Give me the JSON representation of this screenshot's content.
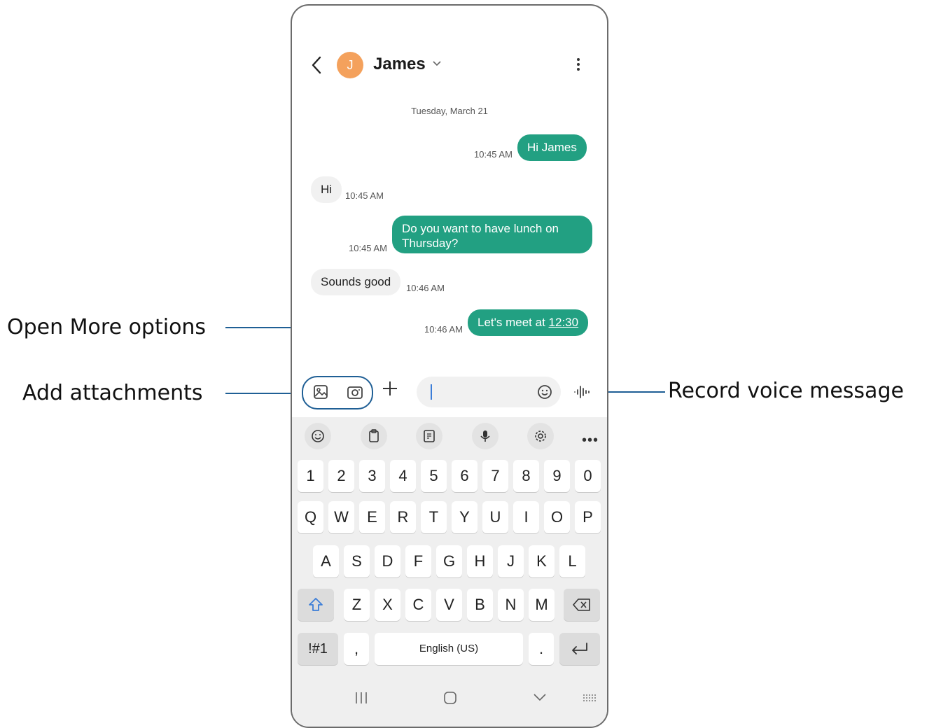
{
  "callouts": {
    "more_options": "Open More options",
    "attachments": "Add attachments",
    "voice": "Record voice message"
  },
  "header": {
    "avatar_initial": "J",
    "contact_name": "James"
  },
  "conversation": {
    "date": "Tuesday, March 21",
    "messages": [
      {
        "dir": "sent",
        "text": "Hi James",
        "time": "10:45 AM"
      },
      {
        "dir": "recv",
        "text": "Hi",
        "time": "10:45 AM"
      },
      {
        "dir": "sent",
        "text": "Do you want to have lunch on Thursday?",
        "time": "10:45 AM"
      },
      {
        "dir": "recv",
        "text": "Sounds good",
        "time": "10:46 AM"
      },
      {
        "dir": "sent",
        "text": "Let's meet at ",
        "link": "12:30",
        "time": "10:46 AM"
      }
    ]
  },
  "keyboard": {
    "row_numbers": [
      "1",
      "2",
      "3",
      "4",
      "5",
      "6",
      "7",
      "8",
      "9",
      "0"
    ],
    "row_top": [
      "Q",
      "W",
      "E",
      "R",
      "T",
      "Y",
      "U",
      "I",
      "O",
      "P"
    ],
    "row_middle": [
      "A",
      "S",
      "D",
      "F",
      "G",
      "H",
      "J",
      "K",
      "L"
    ],
    "row_bottom": [
      "Z",
      "X",
      "C",
      "V",
      "B",
      "N",
      "M"
    ],
    "symbols_key": "!#1",
    "comma_key": ",",
    "space_label": "English (US)",
    "period_key": "."
  },
  "colors": {
    "sent_bubble": "#22a082",
    "received_bubble": "#f1f1f1",
    "avatar": "#f4a15c",
    "callout_line": "#1f5f95",
    "cursor": "#3b7dd8"
  }
}
